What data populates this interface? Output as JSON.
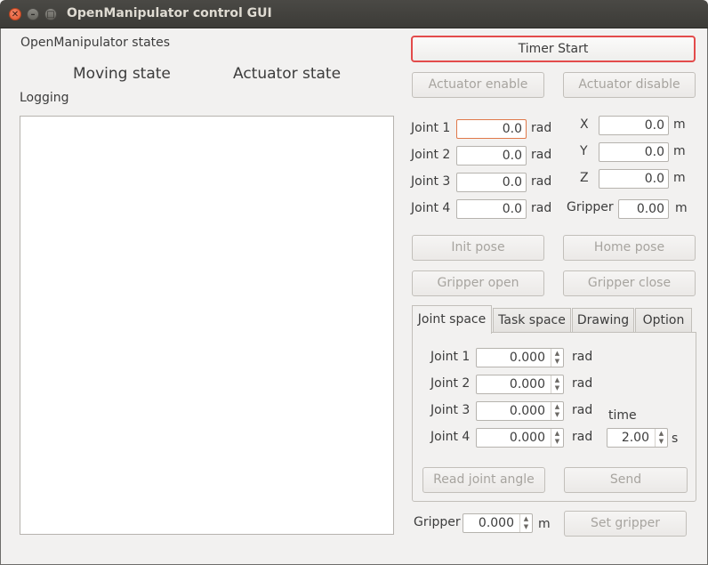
{
  "window": {
    "title": "OpenManipulator control GUI"
  },
  "states": {
    "group_label": "OpenManipulator states",
    "moving_state": "Moving state",
    "actuator_state": "Actuator state",
    "logging_label": "Logging"
  },
  "buttons": {
    "timer_start": "Timer Start",
    "actuator_enable": "Actuator enable",
    "actuator_disable": "Actuator disable",
    "init_pose": "Init pose",
    "home_pose": "Home pose",
    "gripper_open": "Gripper open",
    "gripper_close": "Gripper close",
    "read_joint_angle": "Read joint angle",
    "send": "Send",
    "set_gripper": "Set gripper"
  },
  "joints": [
    {
      "label": "Joint 1",
      "value": "0.0",
      "unit": "rad"
    },
    {
      "label": "Joint 2",
      "value": "0.0",
      "unit": "rad"
    },
    {
      "label": "Joint 3",
      "value": "0.0",
      "unit": "rad"
    },
    {
      "label": "Joint 4",
      "value": "0.0",
      "unit": "rad"
    }
  ],
  "task": [
    {
      "label": "X",
      "value": "0.0",
      "unit": "m"
    },
    {
      "label": "Y",
      "value": "0.0",
      "unit": "m"
    },
    {
      "label": "Z",
      "value": "0.0",
      "unit": "m"
    },
    {
      "label": "Gripper",
      "value": "0.00",
      "unit": "m"
    }
  ],
  "tabs": [
    {
      "label": "Joint space"
    },
    {
      "label": "Task space"
    },
    {
      "label": "Drawing"
    },
    {
      "label": "Option"
    }
  ],
  "joint_space": {
    "rows": [
      {
        "label": "Joint 1",
        "value": "0.000",
        "unit": "rad"
      },
      {
        "label": "Joint 2",
        "value": "0.000",
        "unit": "rad"
      },
      {
        "label": "Joint 3",
        "value": "0.000",
        "unit": "rad"
      },
      {
        "label": "Joint 4",
        "value": "0.000",
        "unit": "rad"
      }
    ],
    "time_label": "time",
    "time_value": "2.00",
    "time_unit": "s"
  },
  "gripper_control": {
    "label": "Gripper",
    "value": "0.000",
    "unit": "m"
  },
  "icons": {
    "close": "close-icon",
    "minimize": "minimize-icon",
    "maximize": "maximize-icon",
    "spin": "spin-arrows-icon"
  }
}
